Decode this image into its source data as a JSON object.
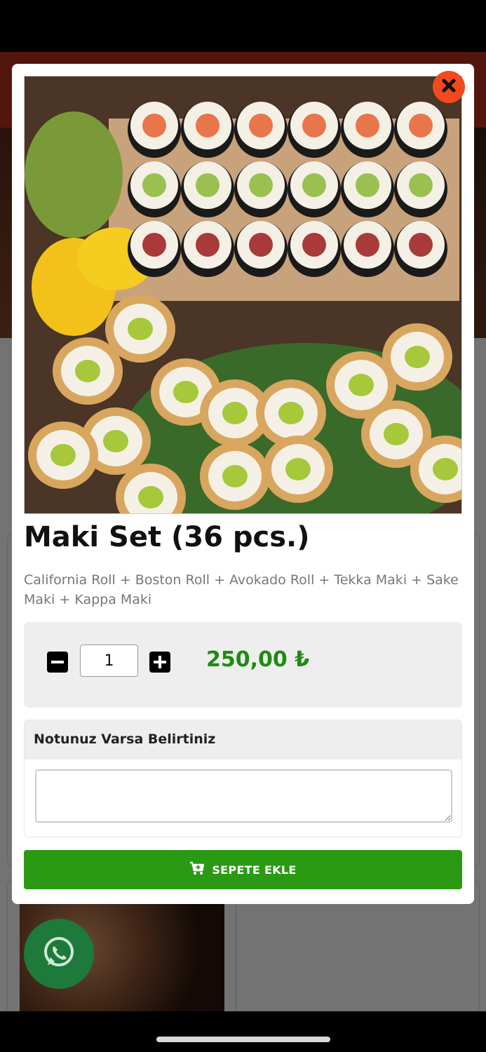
{
  "product": {
    "title": "Maki Set (36 pcs.)",
    "description": "California Roll + Boston Roll + Avokado Roll + Tekka Maki + Sake Maki + Kappa Maki",
    "image_icon": "sushi-photo",
    "price": "250,00 ₺"
  },
  "quantity": {
    "value": "1",
    "decrease_icon": "minus-square-icon",
    "increase_icon": "plus-square-icon"
  },
  "note": {
    "label": "Notunuz Varsa Belirtiniz",
    "value": "",
    "placeholder": ""
  },
  "cart": {
    "add_label": "SEPETE EKLE",
    "icon": "cart-plus-icon"
  },
  "close_icon": "close-icon",
  "whatsapp_icon": "whatsapp-icon",
  "colors": {
    "accent_close": "#f24a1e",
    "price_green": "#1f8a12",
    "cart_button_green": "#2a9a12",
    "header_red": "#b8321f",
    "whatsapp_green": "#1d7a3a"
  }
}
